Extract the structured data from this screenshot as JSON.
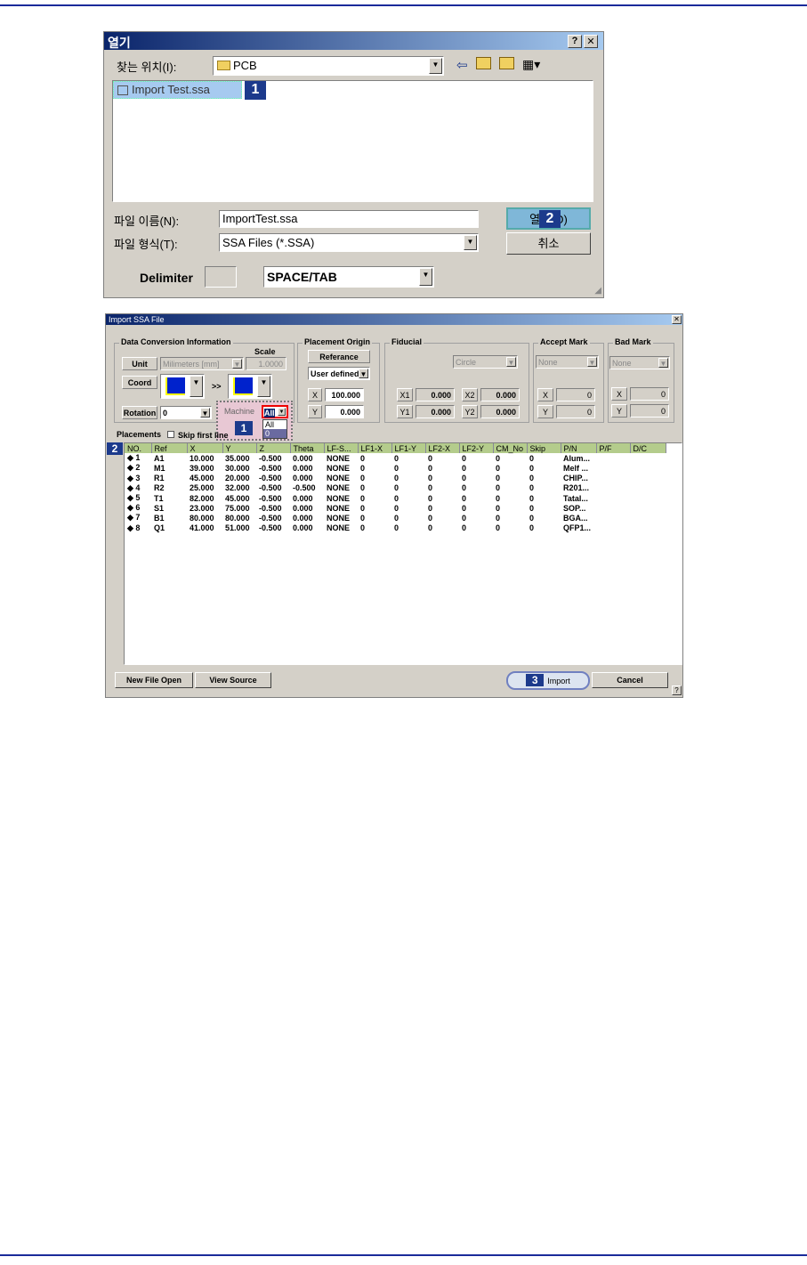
{
  "open_dialog": {
    "title": "열기",
    "help": "?",
    "close": "✕",
    "look_in_label": "찾는 위치(I):",
    "look_in_value": "PCB",
    "file_item": "Import Test.ssa",
    "filename_label": "파일 이름(N):",
    "filename_value": "ImportTest.ssa",
    "filetype_label": "파일 형식(T):",
    "filetype_value": "SSA Files (*.SSA)",
    "open_button": "열기(O)",
    "cancel_button": "취소",
    "delimiter_label": "Delimiter",
    "delimiter_value": "SPACE/TAB"
  },
  "import_dialog": {
    "title": "Import SSA File",
    "close": "✕",
    "conv": {
      "title": "Data Conversion Information",
      "scale_label": "Scale",
      "unit_label": "Unit",
      "unit_value": "Milimeters [mm]",
      "scale_value": "1.0000",
      "coord_label": "Coord",
      "arrow": ">>",
      "rotation_label": "Rotation",
      "rotation_value": "0",
      "machine_label": "Machine",
      "machine_value": "All",
      "machine_options": [
        "All",
        "0"
      ]
    },
    "origin": {
      "title": "Placement Origin",
      "ref_label": "Referance",
      "mode": "User defined",
      "x_label": "X",
      "x_value": "100.000",
      "y_label": "Y",
      "y_value": "0.000"
    },
    "fiducial": {
      "title": "Fiducial",
      "shape": "Circle",
      "x1_label": "X1",
      "x1": "0.000",
      "y1_label": "Y1",
      "y1": "0.000",
      "x2_label": "X2",
      "x2": "0.000",
      "y2_label": "Y2",
      "y2": "0.000"
    },
    "accept": {
      "title": "Accept Mark",
      "value": "None",
      "x_label": "X",
      "x": "0",
      "y_label": "Y",
      "y": "0"
    },
    "bad": {
      "title": "Bad Mark",
      "value": "None",
      "x_label": "X",
      "x": "0",
      "y_label": "Y",
      "y": "0"
    },
    "placements_label": "Placements",
    "skip_label": "Skip first line",
    "columns": [
      "NO.",
      "Ref",
      "X",
      "Y",
      "Z",
      "Theta",
      "LF-S...",
      "LF1-X",
      "LF1-Y",
      "LF2-X",
      "LF2-Y",
      "CM_No",
      "Skip",
      "P/N",
      "P/F",
      "D/C"
    ],
    "rows": [
      [
        "◆ 1",
        "A1",
        "10.000",
        "35.000",
        "-0.500",
        "0.000",
        "NONE",
        "0",
        "0",
        "0",
        "0",
        "0",
        "0",
        "Alum...",
        "",
        ""
      ],
      [
        "◆ 2",
        "M1",
        "39.000",
        "30.000",
        "-0.500",
        "0.000",
        "NONE",
        "0",
        "0",
        "0",
        "0",
        "0",
        "0",
        "Melf ...",
        "",
        ""
      ],
      [
        "◆ 3",
        "R1",
        "45.000",
        "20.000",
        "-0.500",
        "0.000",
        "NONE",
        "0",
        "0",
        "0",
        "0",
        "0",
        "0",
        "CHIP...",
        "",
        ""
      ],
      [
        "◆ 4",
        "R2",
        "25.000",
        "32.000",
        "-0.500",
        "-0.500",
        "NONE",
        "0",
        "0",
        "0",
        "0",
        "0",
        "0",
        "R201...",
        "",
        ""
      ],
      [
        "◆ 5",
        "T1",
        "82.000",
        "45.000",
        "-0.500",
        "0.000",
        "NONE",
        "0",
        "0",
        "0",
        "0",
        "0",
        "0",
        "Tatal...",
        "",
        ""
      ],
      [
        "◆ 6",
        "S1",
        "23.000",
        "75.000",
        "-0.500",
        "0.000",
        "NONE",
        "0",
        "0",
        "0",
        "0",
        "0",
        "0",
        "SOP...",
        "",
        ""
      ],
      [
        "◆ 7",
        "B1",
        "80.000",
        "80.000",
        "-0.500",
        "0.000",
        "NONE",
        "0",
        "0",
        "0",
        "0",
        "0",
        "0",
        "BGA...",
        "",
        ""
      ],
      [
        "◆ 8",
        "Q1",
        "41.000",
        "51.000",
        "-0.500",
        "0.000",
        "NONE",
        "0",
        "0",
        "0",
        "0",
        "0",
        "0",
        "QFP1...",
        "",
        ""
      ]
    ],
    "new_file_button": "New File Open",
    "view_source_button": "View Source",
    "import_button": "Import",
    "cancel_button": "Cancel",
    "help": "?"
  },
  "badges": {
    "b1": "1",
    "b2": "2",
    "b3": "3"
  }
}
